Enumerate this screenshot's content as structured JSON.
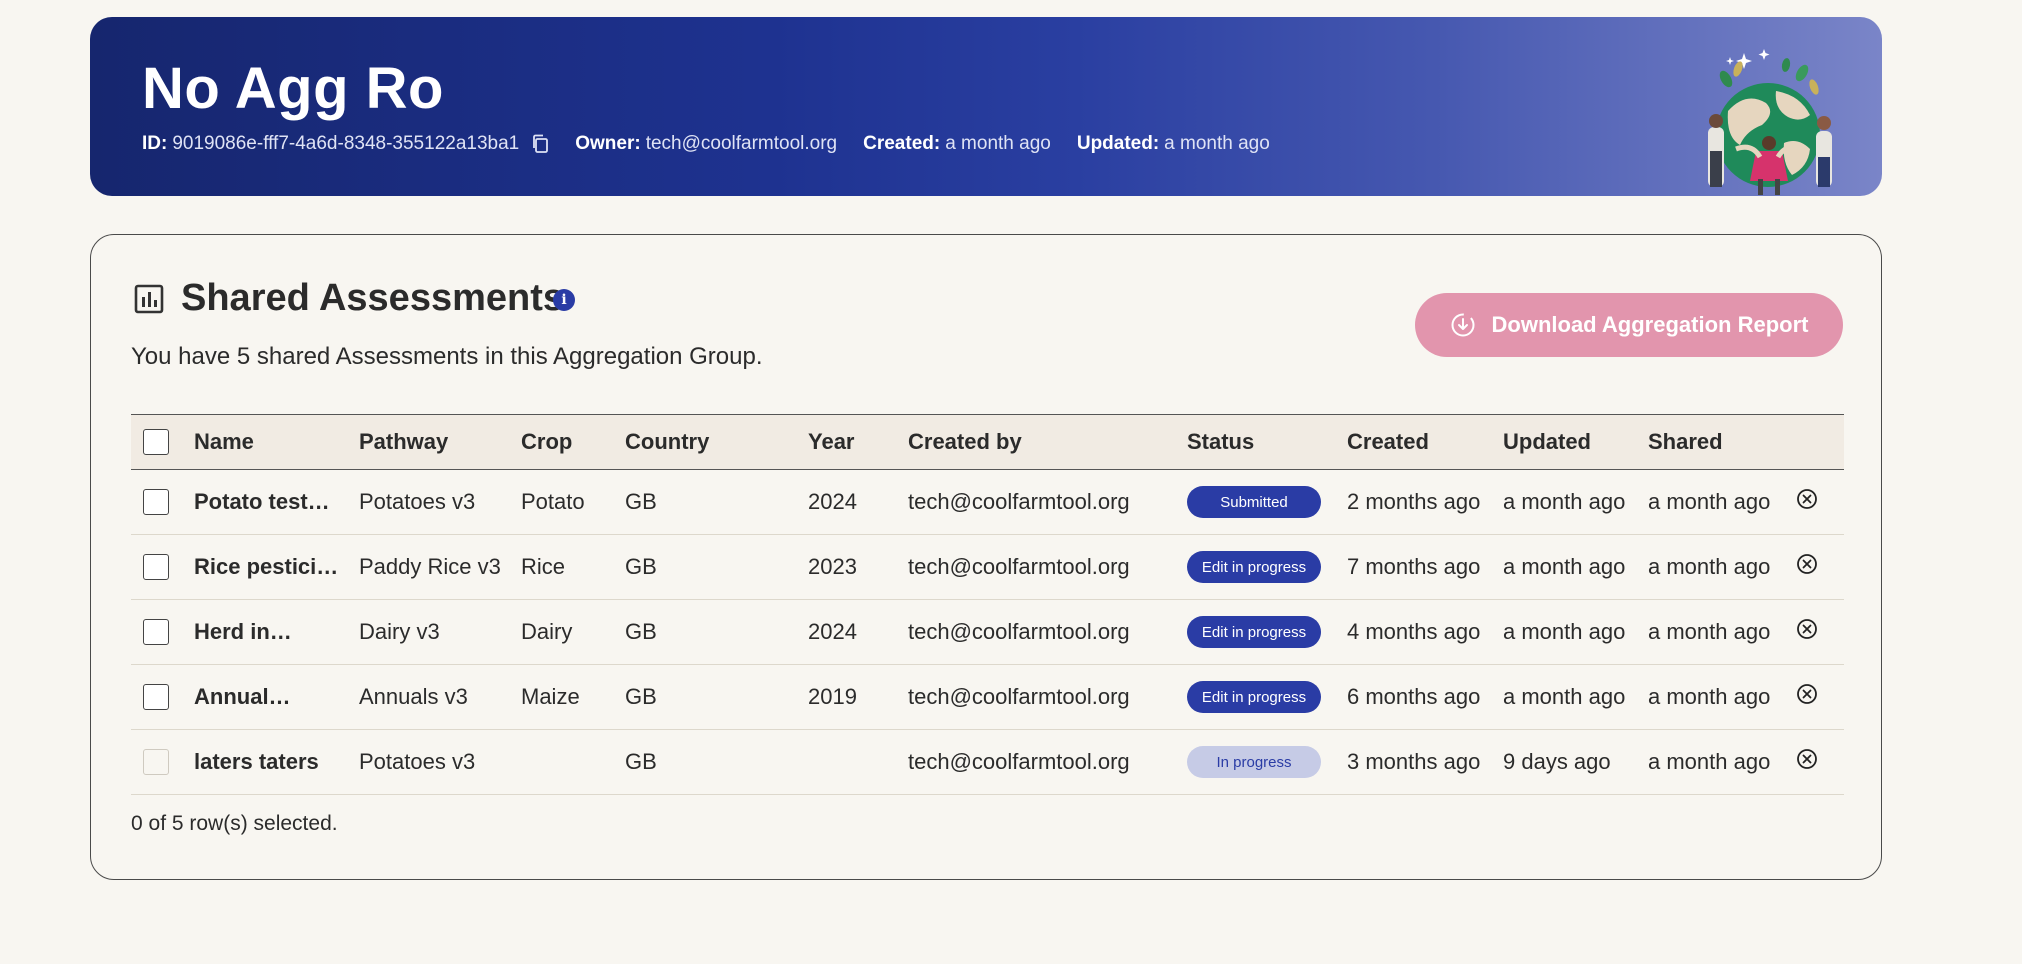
{
  "header": {
    "title": "No Agg Ro",
    "id_label": "ID:",
    "id_value": "9019086e-fff7-4a6d-8348-355122a13ba1",
    "owner_label": "Owner:",
    "owner_value": "tech@coolfarmtool.org",
    "created_label": "Created:",
    "created_value": "a month ago",
    "updated_label": "Updated:",
    "updated_value": "a month ago",
    "copy_icon": "copy-icon",
    "illustration": "globe-people-illustration"
  },
  "card": {
    "icon": "bar-chart-icon",
    "title": "Shared Assessments",
    "info_icon": "info-icon",
    "subtitle": "You have 5 shared Assessments in this Aggregation Group.",
    "download_label": "Download Aggregation Report",
    "download_icon": "download-icon",
    "footer": "0 of 5 row(s) selected."
  },
  "table": {
    "columns": [
      "Name",
      "Pathway",
      "Crop",
      "Country",
      "Year",
      "Created by",
      "Status",
      "Created",
      "Updated",
      "Shared"
    ],
    "rows": [
      {
        "name": "Potato test…",
        "pathway": "Potatoes v3",
        "crop": "Potato",
        "country": "GB",
        "year": "2024",
        "created_by": "tech@coolfarmtool.org",
        "status": "Submitted",
        "created": "2 months ago",
        "updated": "a month ago",
        "shared": "a month ago"
      },
      {
        "name": "Rice pestici…",
        "pathway": "Paddy Rice v3",
        "crop": "Rice",
        "country": "GB",
        "year": "2023",
        "created_by": "tech@coolfarmtool.org",
        "status": "Edit in progress",
        "created": "7 months ago",
        "updated": "a month ago",
        "shared": "a month ago"
      },
      {
        "name": "Herd in…",
        "pathway": "Dairy v3",
        "crop": "Dairy",
        "country": "GB",
        "year": "2024",
        "created_by": "tech@coolfarmtool.org",
        "status": "Edit in progress",
        "created": "4 months ago",
        "updated": "a month ago",
        "shared": "a month ago"
      },
      {
        "name": "Annual…",
        "pathway": "Annuals v3",
        "crop": "Maize",
        "country": "GB",
        "year": "2019",
        "created_by": "tech@coolfarmtool.org",
        "status": "Edit in progress",
        "created": "6 months ago",
        "updated": "a month ago",
        "shared": "a month ago"
      },
      {
        "name": "laters taters",
        "pathway": "Potatoes v3",
        "crop": "",
        "country": "GB",
        "year": "",
        "created_by": "tech@coolfarmtool.org",
        "status": "In progress",
        "created": "3 months ago",
        "updated": "9 days ago",
        "shared": "a month ago"
      }
    ]
  },
  "colors": {
    "banner_dark": "#16266e",
    "accent_blue": "#2a3ca5",
    "download_pink": "#e295ad",
    "badge_light": "#c6cbe6",
    "page_bg": "#f8f6f1"
  }
}
